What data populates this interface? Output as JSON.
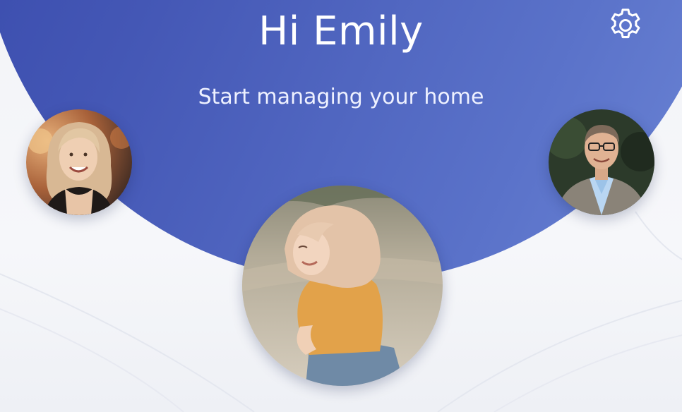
{
  "header": {
    "greeting": "Hi Emily",
    "subtitle": "Start managing your home",
    "settings_icon": "gear-icon"
  },
  "members": [
    {
      "icon": "avatar-woman-blonde"
    },
    {
      "icon": "avatar-man-glasses"
    },
    {
      "icon": "avatar-girl-yellow-shirt"
    }
  ],
  "colors": {
    "hero_start": "#3445a8",
    "hero_end": "#6d86d6",
    "background": "#f4f5f9",
    "text_on_hero": "#ffffff"
  }
}
